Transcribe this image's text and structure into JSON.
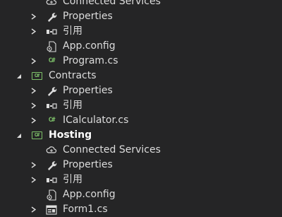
{
  "tree": [
    {
      "level": 2,
      "arrow": "none",
      "icon": "cloud-icon",
      "label": "Connected Services",
      "bold": false
    },
    {
      "level": 2,
      "arrow": "collapsed",
      "icon": "wrench-icon",
      "label": "Properties",
      "bold": false
    },
    {
      "level": 2,
      "arrow": "collapsed",
      "icon": "reference-icon",
      "label": "引用",
      "bold": false
    },
    {
      "level": 2,
      "arrow": "none",
      "icon": "config-icon",
      "label": "App.config",
      "bold": false
    },
    {
      "level": 2,
      "arrow": "collapsed",
      "icon": "csharp-file-icon",
      "label": "Program.cs",
      "bold": false
    },
    {
      "level": 1,
      "arrow": "expanded",
      "icon": "csharp-project-icon",
      "label": "Contracts",
      "bold": false
    },
    {
      "level": 2,
      "arrow": "collapsed",
      "icon": "wrench-icon",
      "label": "Properties",
      "bold": false
    },
    {
      "level": 2,
      "arrow": "collapsed",
      "icon": "reference-icon",
      "label": "引用",
      "bold": false
    },
    {
      "level": 2,
      "arrow": "collapsed",
      "icon": "csharp-file-icon",
      "label": "ICalculator.cs",
      "bold": false
    },
    {
      "level": 1,
      "arrow": "expanded",
      "icon": "csharp-project-icon",
      "label": "Hosting",
      "bold": true
    },
    {
      "level": 2,
      "arrow": "none",
      "icon": "cloud-icon",
      "label": "Connected Services",
      "bold": false
    },
    {
      "level": 2,
      "arrow": "collapsed",
      "icon": "wrench-icon",
      "label": "Properties",
      "bold": false
    },
    {
      "level": 2,
      "arrow": "collapsed",
      "icon": "reference-icon",
      "label": "引用",
      "bold": false
    },
    {
      "level": 2,
      "arrow": "none",
      "icon": "config-icon",
      "label": "App.config",
      "bold": false
    },
    {
      "level": 2,
      "arrow": "collapsed",
      "icon": "form-file-icon",
      "label": "Form1.cs",
      "bold": false
    }
  ],
  "icon_glyphs": {
    "csharp": "C#"
  },
  "colors": {
    "background": "#252526",
    "text": "#dcdcdc",
    "csharp_green": "#7ec26a"
  }
}
